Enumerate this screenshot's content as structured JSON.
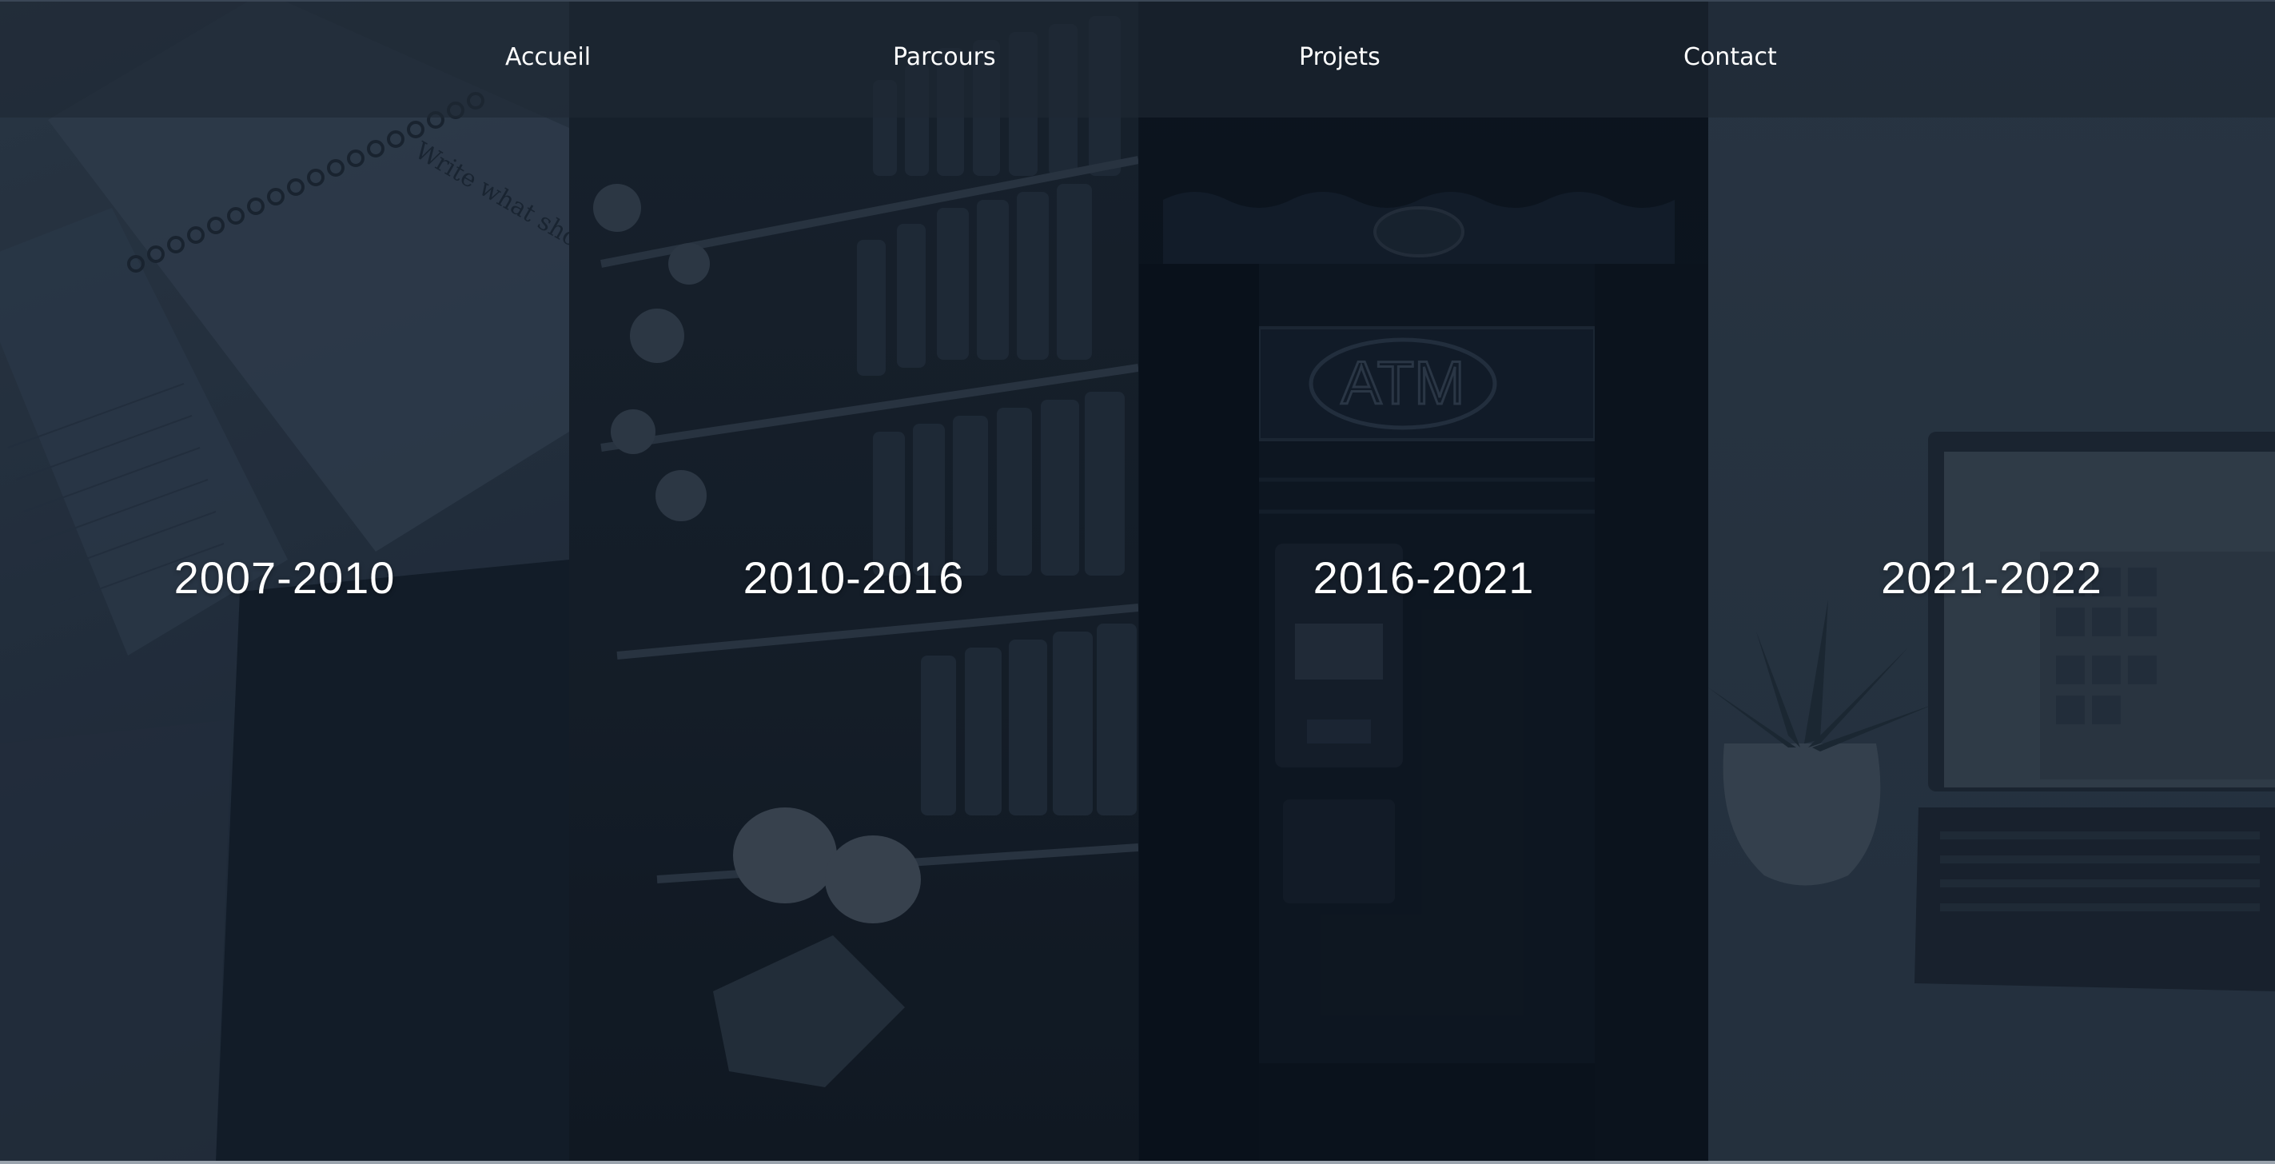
{
  "nav": {
    "items": [
      {
        "label": "Accueil"
      },
      {
        "label": "Parcours"
      },
      {
        "label": "Projets"
      },
      {
        "label": "Contact"
      }
    ]
  },
  "timeline": {
    "periods": [
      {
        "label": "2007-2010",
        "image": "notebook-photo"
      },
      {
        "label": "2010-2016",
        "image": "supermarket-shelves-photo"
      },
      {
        "label": "2016-2021",
        "image": "atm-photo"
      },
      {
        "label": "2021-2022",
        "image": "laptop-plant-photo"
      }
    ]
  },
  "photo_text": {
    "notebook_quote": "Write what should not be forgotten.",
    "atm_sign": "ATM"
  }
}
